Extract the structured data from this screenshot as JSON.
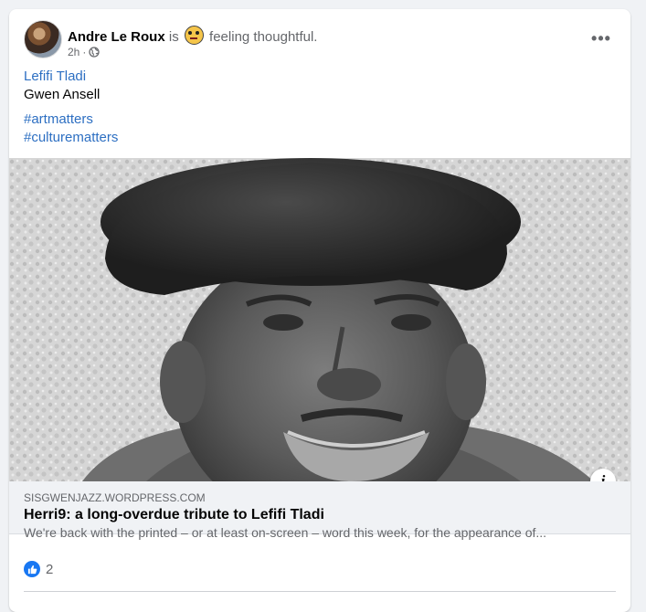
{
  "post": {
    "author": "Andre Le Roux",
    "connector": "is",
    "feeling": "feeling thoughtful.",
    "time": "2h",
    "separator": "·",
    "more_label": "•••",
    "body": {
      "line1": "Lefifi Tladi",
      "line2": "Gwen Ansell",
      "hashtag1": "#artmatters",
      "hashtag2": "#culturematters"
    },
    "link_preview": {
      "domain": "SISGWENJAZZ.WORDPRESS.COM",
      "title": "Herri9: a long-overdue tribute to Lefifi Tladi",
      "description": "We're back with the printed – or at least on-screen – word this week, for the appearance of...",
      "info_label": "i"
    },
    "reactions": {
      "count": "2"
    }
  },
  "colors": {
    "link": "#2d6fc2",
    "like": "#1877f2",
    "muted": "#65676b"
  }
}
